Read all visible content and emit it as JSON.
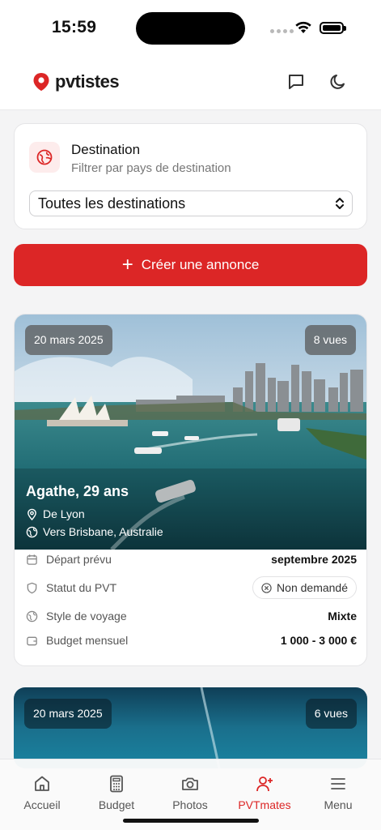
{
  "status_bar": {
    "time": "15:59"
  },
  "header": {
    "logo_text": "pvtistes",
    "icons": [
      "chat-icon",
      "moon-icon"
    ]
  },
  "filter": {
    "title": "Destination",
    "subtitle": "Filtrer par pays de destination",
    "selected": "Toutes les destinations",
    "accent": "#dc2626"
  },
  "create_button": {
    "label": "Créer une annonce"
  },
  "posts": [
    {
      "date": "20 mars 2025",
      "views": "8 vues",
      "name": "Agathe, 29 ans",
      "from": "De Lyon",
      "to": "Vers Brisbane, Australie",
      "details": [
        {
          "label": "Départ prévu",
          "value": "septembre 2025",
          "icon": "calendar-icon"
        },
        {
          "label": "Statut du PVT",
          "value": "Non demandé",
          "icon": "shield-icon"
        },
        {
          "label": "Style de voyage",
          "value": "Mixte",
          "icon": "globe-icon"
        },
        {
          "label": "Budget mensuel",
          "value": "1 000 - 3 000 €",
          "icon": "wallet-icon"
        }
      ]
    },
    {
      "date": "20 mars 2025",
      "views": "6 vues"
    }
  ],
  "tabs": [
    {
      "label": "Accueil",
      "icon": "home-icon",
      "active": false
    },
    {
      "label": "Budget",
      "icon": "calculator-icon",
      "active": false
    },
    {
      "label": "Photos",
      "icon": "camera-icon",
      "active": false
    },
    {
      "label": "PVTmates",
      "icon": "user-plus-icon",
      "active": true
    },
    {
      "label": "Menu",
      "icon": "menu-icon",
      "active": false
    }
  ]
}
